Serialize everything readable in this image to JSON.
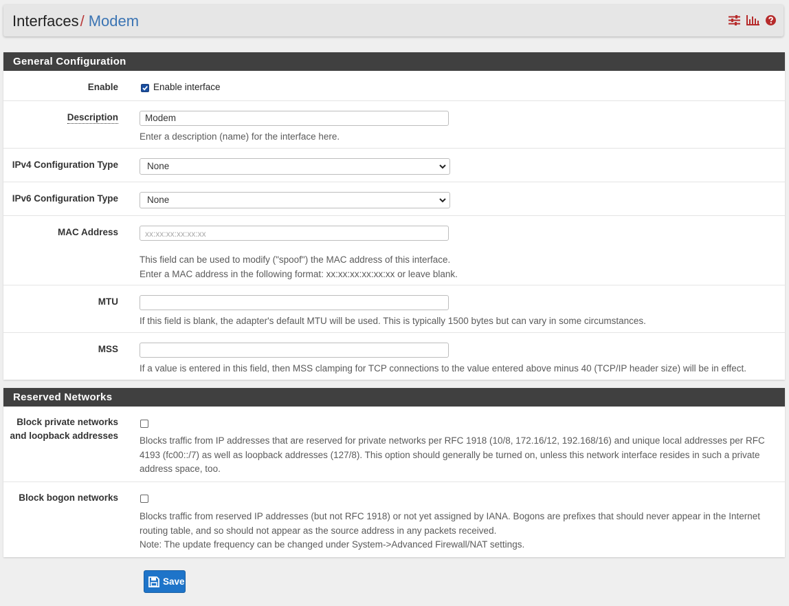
{
  "breadcrumb": {
    "parent": "Interfaces",
    "separator": "/",
    "current": "Modem"
  },
  "toolbar_icons": [
    "sliders-icon",
    "bar-chart-icon",
    "help-icon"
  ],
  "colors": {
    "panel_header": "#404040",
    "accent": "#3b74b3",
    "save_button": "#1e74c9"
  },
  "general": {
    "title": "General Configuration",
    "enable": {
      "label": "Enable",
      "checkbox_label": "Enable interface",
      "checked": true
    },
    "description": {
      "label": "Description",
      "value": "Modem",
      "help": "Enter a description (name) for the interface here."
    },
    "ipv4": {
      "label": "IPv4 Configuration Type",
      "value": "None"
    },
    "ipv6": {
      "label": "IPv6 Configuration Type",
      "value": "None"
    },
    "mac": {
      "label": "MAC Address",
      "placeholder": "xx:xx:xx:xx:xx:xx",
      "help1": "This field can be used to modify (\"spoof\") the MAC address of this interface.",
      "help2": "Enter a MAC address in the following format: xx:xx:xx:xx:xx:xx or leave blank."
    },
    "mtu": {
      "label": "MTU",
      "value": "",
      "help": "If this field is blank, the adapter's default MTU will be used. This is typically 1500 bytes but can vary in some circumstances."
    },
    "mss": {
      "label": "MSS",
      "value": "",
      "help": "If a value is entered in this field, then MSS clamping for TCP connections to the value entered above minus 40 (TCP/IP header size) will be in effect."
    }
  },
  "reserved": {
    "title": "Reserved Networks",
    "private": {
      "label1": "Block private networks",
      "label2": "and loopback addresses",
      "checked": false,
      "help": "Blocks traffic from IP addresses that are reserved for private networks per RFC 1918 (10/8, 172.16/12, 192.168/16) and unique local addresses per RFC 4193 (fc00::/7) as well as loopback addresses (127/8). This option should generally be turned on, unless this network interface resides in such a private address space, too."
    },
    "bogon": {
      "label": "Block bogon networks",
      "checked": false,
      "help1": "Blocks traffic from reserved IP addresses (but not RFC 1918) or not yet assigned by IANA. Bogons are prefixes that should never appear in the Internet routing table, and so should not appear as the source address in any packets received.",
      "help2": "Note: The update frequency can be changed under System->Advanced Firewall/NAT settings."
    }
  },
  "save_label": "Save"
}
